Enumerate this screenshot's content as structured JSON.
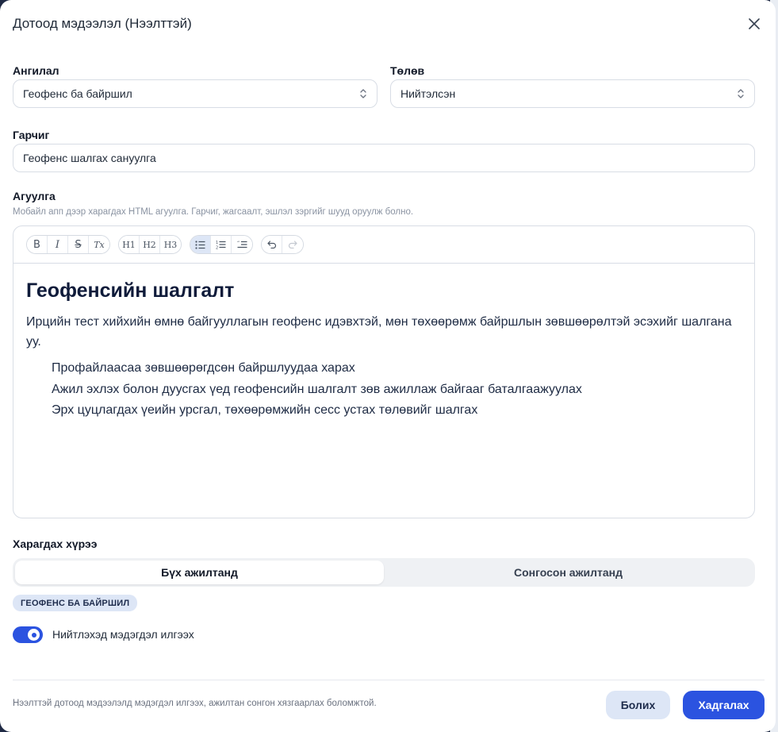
{
  "modal": {
    "title": "Дотоод мэдээлэл (Нээлттэй)"
  },
  "category": {
    "label": "Ангилал",
    "value": "Геофенс ба байршил"
  },
  "status": {
    "label": "Төлөв",
    "value": "Нийтэлсэн"
  },
  "title_field": {
    "label": "Гарчиг",
    "value": "Геофенс шалгах сануулга"
  },
  "content_field": {
    "label": "Агуулга",
    "help": "Мобайл апп дээр харагдах HTML агуулга. Гарчиг, жагсаалт, эшлэл зэргийг шууд оруулж болно."
  },
  "toolbar": {
    "bold": "B",
    "italic": "I",
    "strike": "S",
    "clear": "Tx",
    "h1": "H1",
    "h2": "H2",
    "h3": "H3"
  },
  "editor": {
    "heading": "Геофенсийн шалгалт",
    "paragraph": "Ирцийн тест хийхийн өмнө байгууллагын геофенс идэвхтэй, мөн төхөөрөмж байршлын зөвшөөрөлтэй эсэхийг шалгана уу.",
    "items": [
      "Профайлаасаа зөвшөөрөгдсөн байршлуудаа харах",
      "Ажил эхлэх болон дуусгах үед геофенсийн шалгалт зөв ажиллаж байгааг баталгаажуулах",
      "Эрх цуцлагдах үеийн урсгал, төхөөрөмжийн сесс устах төлөвийг шалгах"
    ]
  },
  "audience": {
    "label": "Харагдах хүрээ",
    "options": [
      "Бүх ажилтанд",
      "Сонгосон ажилтанд"
    ],
    "selected": "Бүх ажилтанд"
  },
  "badge": "ГЕОФЕНС БА БАЙРШИЛ",
  "notify": {
    "label": "Нийтлэхэд мэдэгдэл илгээх",
    "enabled": true
  },
  "footer": {
    "note": "Нээлттэй дотоод мэдээлэлд мэдэгдэл илгээх, ажилтан сонгон хязгаарлах боломжтой.",
    "cancel": "Болих",
    "save": "Хадгалах"
  },
  "colors": {
    "primary": "#2b53e0",
    "soft": "#dde6f6"
  }
}
